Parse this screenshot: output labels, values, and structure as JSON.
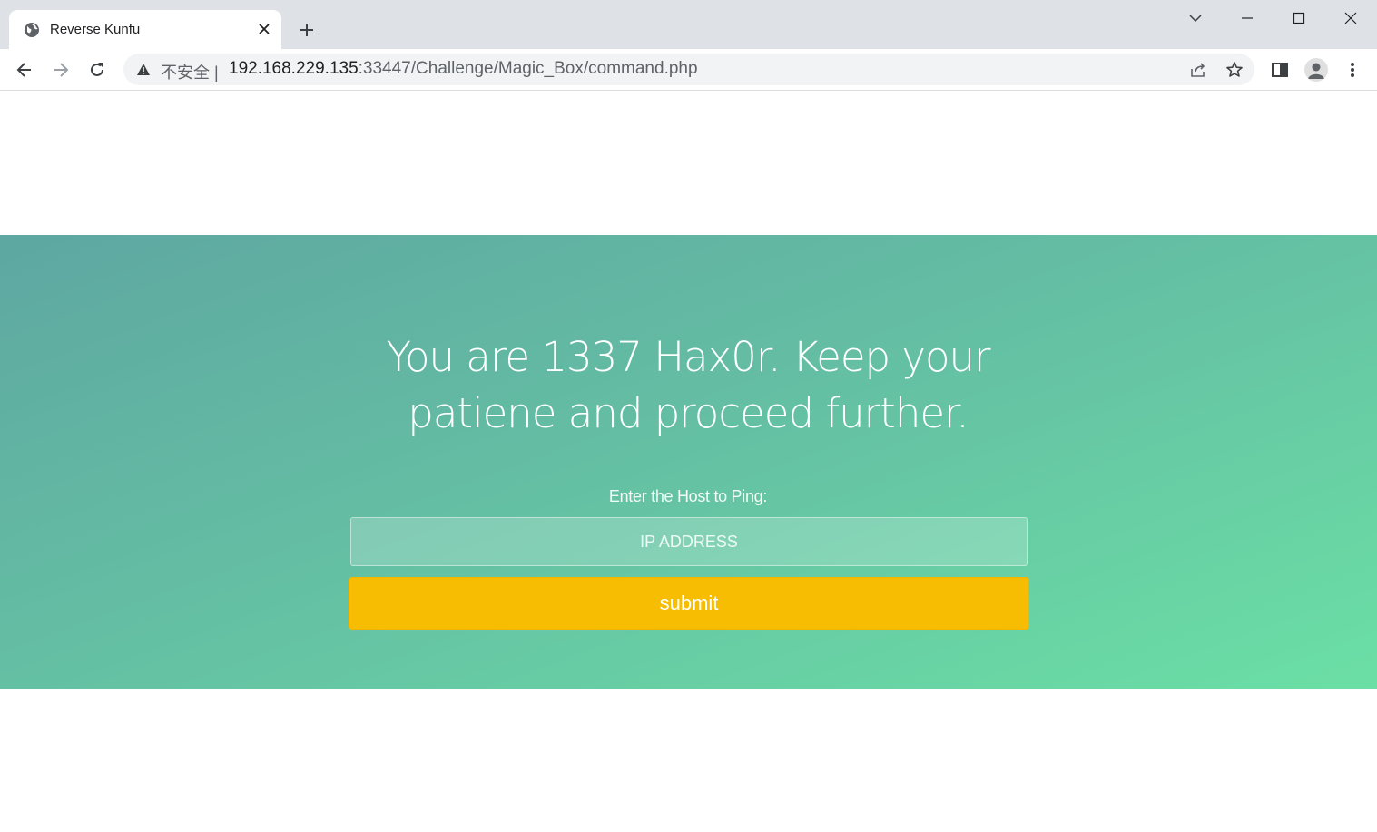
{
  "browser": {
    "tab_title": "Reverse Kunfu",
    "security_label": "不安全",
    "url_host": "192.168.229.135",
    "url_path": ":33447/Challenge/Magic_Box/command.php"
  },
  "page": {
    "headline": "You are 1337 Hax0r. Keep your patiene and proceed further.",
    "ping_label": "Enter the Host to Ping:",
    "ip_placeholder": "IP ADDRESS",
    "ip_value": "",
    "submit_label": "submit"
  },
  "colors": {
    "hero_gradient_start": "#5ea7a2",
    "hero_gradient_end": "#6bdfa5",
    "submit_button": "#f7bd02",
    "tabstrip": "#dee1e6"
  }
}
